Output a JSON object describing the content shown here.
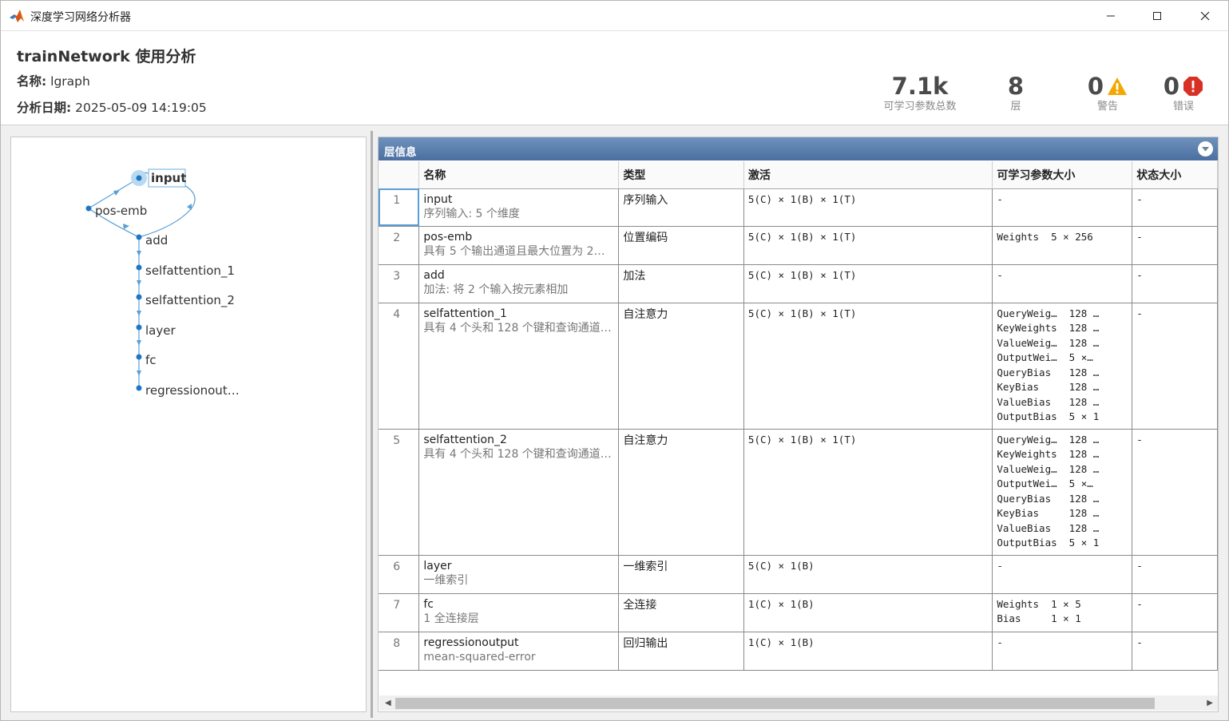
{
  "window": {
    "title": "深度学习网络分析器"
  },
  "header": {
    "title": "trainNetwork 使用分析",
    "name_label": "名称:",
    "name_value": "lgraph",
    "date_label": "分析日期:",
    "date_value": "2025-05-09 14:19:05"
  },
  "stats": [
    {
      "value": "7.1k",
      "label": "可学习参数总数"
    },
    {
      "value": "8",
      "label": "层"
    },
    {
      "value": "0",
      "label": "警告"
    },
    {
      "value": "0",
      "label": "错误"
    }
  ],
  "graph": {
    "nodes": [
      "input",
      "pos-emb",
      "add",
      "selfattention_1",
      "selfattention_2",
      "layer",
      "fc",
      "regressionout…"
    ],
    "selected": "input"
  },
  "panel": {
    "title": "层信息"
  },
  "table": {
    "headers": [
      "",
      "名称",
      "类型",
      "激活",
      "可学习参数大小",
      "状态大小"
    ],
    "rows": [
      {
        "idx": "1",
        "name": "input",
        "desc": "序列输入: 5 个维度",
        "type": "序列输入",
        "activation": "5(C) × 1(B) × 1(T)",
        "learnables": "-",
        "state": "-"
      },
      {
        "idx": "2",
        "name": "pos-emb",
        "desc": "具有 5 个输出通道且最大位置为 2…",
        "type": "位置编码",
        "activation": "5(C) × 1(B) × 1(T)",
        "learnables": "Weights  5 × 256",
        "state": "-"
      },
      {
        "idx": "3",
        "name": "add",
        "desc": "加法: 将 2 个输入按元素相加",
        "type": "加法",
        "activation": "5(C) × 1(B) × 1(T)",
        "learnables": "-",
        "state": "-"
      },
      {
        "idx": "4",
        "name": "selfattention_1",
        "desc": "具有 4 个头和 128 个键和查询通道…",
        "type": "自注意力",
        "activation": "5(C) × 1(B) × 1(T)",
        "learnables": "QueryWeig…  128 …\nKeyWeights  128 …\nValueWeig…  128 …\nOutputWei…  5 ×…\nQueryBias   128 …\nKeyBias     128 …\nValueBias   128 …\nOutputBias  5 × 1",
        "state": "-"
      },
      {
        "idx": "5",
        "name": "selfattention_2",
        "desc": "具有 4 个头和 128 个键和查询通道…",
        "type": "自注意力",
        "activation": "5(C) × 1(B) × 1(T)",
        "learnables": "QueryWeig…  128 …\nKeyWeights  128 …\nValueWeig…  128 …\nOutputWei…  5 ×…\nQueryBias   128 …\nKeyBias     128 …\nValueBias   128 …\nOutputBias  5 × 1",
        "state": "-"
      },
      {
        "idx": "6",
        "name": "layer",
        "desc": "一维索引",
        "type": "一维索引",
        "activation": "5(C) × 1(B)",
        "learnables": "-",
        "state": "-"
      },
      {
        "idx": "7",
        "name": "fc",
        "desc": "1 全连接层",
        "type": "全连接",
        "activation": "1(C) × 1(B)",
        "learnables": "Weights  1 × 5\nBias     1 × 1",
        "state": "-"
      },
      {
        "idx": "8",
        "name": "regressionoutput",
        "desc": "mean-squared-error",
        "type": "回归输出",
        "activation": "1(C) × 1(B)",
        "learnables": "-",
        "state": "-"
      }
    ]
  },
  "colors": {
    "accent": "#4a6fa0",
    "node": "#1f77c4",
    "warning": "#f2a800",
    "error": "#d93025"
  }
}
